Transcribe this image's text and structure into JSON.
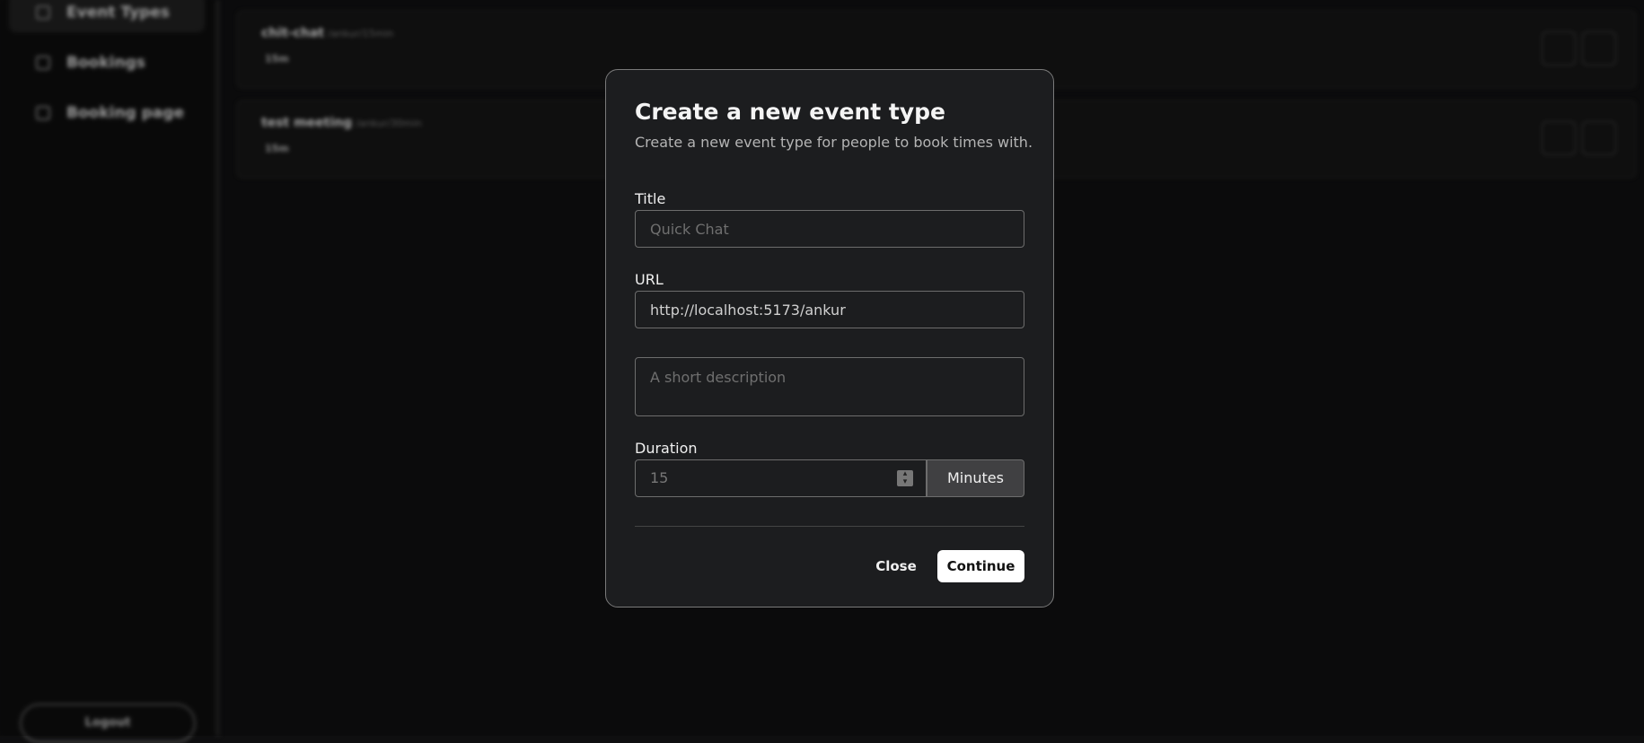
{
  "sidebar": {
    "items": [
      {
        "label": "Event Types",
        "icon": "pencil-icon"
      },
      {
        "label": "Bookings",
        "icon": "calendar-icon"
      },
      {
        "label": "Booking page",
        "icon": "external-link-icon"
      }
    ],
    "logout_label": "Logout"
  },
  "events": [
    {
      "title": "chit-chat",
      "url": "/ankur/15min",
      "duration": "15m"
    },
    {
      "title": "test meeting",
      "url": "/ankur/30min",
      "duration": "15m"
    }
  ],
  "modal": {
    "title": "Create a new event type",
    "subtitle": "Create a new event type for people to book times with.",
    "title_label": "Title",
    "title_placeholder": "Quick Chat",
    "url_label": "URL",
    "url_value": "http://localhost:5173/ankur",
    "description_placeholder": "A short description",
    "duration_label": "Duration",
    "duration_value": "15",
    "duration_unit": "Minutes",
    "close_label": "Close",
    "continue_label": "Continue"
  }
}
